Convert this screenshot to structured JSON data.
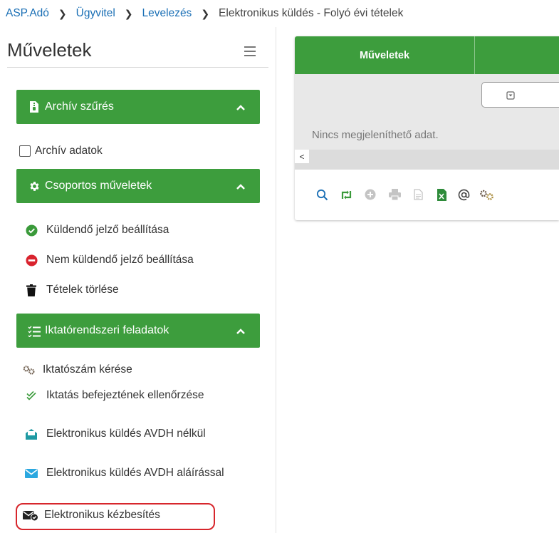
{
  "breadcrumb": {
    "items": [
      "ASP.Adó",
      "Ügyvitel",
      "Levelezés"
    ],
    "current": "Elektronikus küldés - Folyó évi tételek"
  },
  "sidebar": {
    "title": "Műveletek",
    "panels": {
      "archive_filter": "Archív szűrés",
      "bulk_ops": "Csoportos műveletek",
      "registry_tasks": "Iktatórendszeri feladatok"
    },
    "archive_checkbox_label": "Archív adatok",
    "bulk_items": [
      "Küldendő jelző beállítása",
      "Nem küldendő jelző beállítása",
      "Tételek törlése"
    ],
    "registry_items": [
      "Iktatószám kérése",
      "Iktatás befejeztének ellenőrzése",
      "Elektronikus küldés AVDH nélkül",
      "Elektronikus küldés AVDH aláírással",
      "Elektronikus kézbesítés"
    ]
  },
  "grid": {
    "column_header": "Műveletek",
    "empty_message": "Nincs megjeleníthető adat.",
    "scroll_left": "<"
  },
  "colors": {
    "green": "#3d9d3d",
    "link_blue": "#1a6fb5",
    "highlight_red": "#d7262c",
    "check_green": "#3a9a3a",
    "minus_red": "#d9232e",
    "mail_teal": "#1f9aa3",
    "mail_blue": "#2ba8e0"
  }
}
